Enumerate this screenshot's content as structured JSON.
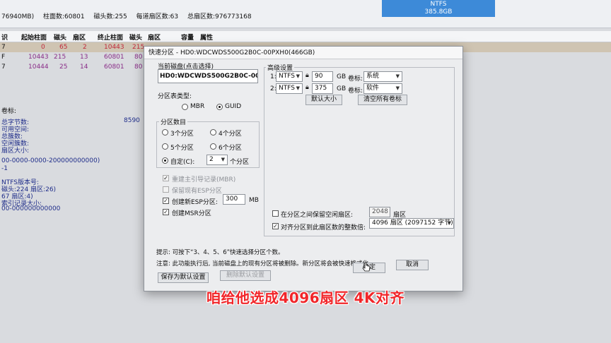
{
  "bg": {
    "info": {
      "sectors": "76940MB)",
      "cylinders": "柱面数:60801",
      "heads": "磁头数:255",
      "spt": "每道扇区数:63",
      "total": "总扇区数:976773168"
    },
    "disk_widget": {
      "fs": "NTFS",
      "size": "385.8GB"
    },
    "table": {
      "headers": [
        "识",
        "起始柱面",
        "磁头",
        "扇区",
        "终止柱面",
        "磁头",
        "扇区",
        "容量",
        "属性"
      ],
      "rows": [
        [
          "7",
          "0",
          "65",
          "2",
          "10443",
          "215",
          ""
        ],
        [
          "F",
          "10443",
          "215",
          "13",
          "60801",
          "80",
          ""
        ],
        [
          "7",
          "10444",
          "25",
          "14",
          "60801",
          "80",
          ""
        ]
      ]
    },
    "panel": {
      "volume_label": "卷标:",
      "total_bytes": "总字节数:",
      "free_space": "可用空间:",
      "total_clusters": "总簇数:",
      "free_clusters": "空闲簇数:",
      "sector_size": "扇区大小:",
      "val1": "8590",
      "guid": "00-0000-0000-200000000000)",
      "one": "-1",
      "ntfs_version": "NTFS版本号:",
      "mft": "磁头:224 扇区:26)",
      "mft2": "67 扇区:4)",
      "index_size": "索引记录大小:",
      "serial": "00-000000000000"
    }
  },
  "dialog": {
    "title": "快速分区 - HD0:WDCWDS500G2B0C-00PXH0(466GB)",
    "current_disk_label": "当前磁盘(点击选择)",
    "current_disk_value": "HD0:WDCWDS500G2B0C-00PX",
    "partition_table_label": "分区表类型:",
    "mbr": "MBR",
    "guid": "GUID",
    "partition_count_label": "分区数目",
    "opt3": "3个分区",
    "opt4": "4个分区",
    "opt5": "5个分区",
    "opt6": "6个分区",
    "custom": "自定(C):",
    "custom_value": "2",
    "custom_suffix": "个分区",
    "rebuild_mbr": "重建主引导记录(MBR)",
    "keep_esp": "保留现有ESP分区",
    "create_esp": "创建新ESP分区:",
    "esp_size": "300",
    "esp_unit": "MB",
    "create_msr": "创建MSR分区",
    "advanced_label": "高级设置",
    "partitions": [
      {
        "num": "1:",
        "fs": "NTFS",
        "size": "90",
        "unit": "GB",
        "label_text": "卷标:",
        "volume": "系统"
      },
      {
        "num": "2:",
        "fs": "NTFS",
        "size": "375",
        "unit": "GB",
        "label_text": "卷标:",
        "volume": "软件"
      }
    ],
    "default_size_btn": "默认大小",
    "clear_labels_btn": "清空所有卷标",
    "keep_free_label": "在分区之间保留空闲扇区:",
    "keep_free_value": "2048",
    "keep_free_unit": "扇区",
    "align_label": "对齐分区到此扇区数的整数倍:",
    "align_value": "4096 扇区 (2097152 字节)",
    "hint1": "提示: 可按下“3、4、5、6”快速选择分区个数。",
    "hint2": "注意: 此功能执行后, 当前磁盘上的现有分区将被删除。新分区将会被快速格式化。",
    "save_default_btn": "保存为默认设置",
    "delete_default_btn": "删除默认设置",
    "ok_btn": "确定",
    "cancel_btn": "取消"
  },
  "caption": "咱给他选成4096扇区   4K对齐"
}
